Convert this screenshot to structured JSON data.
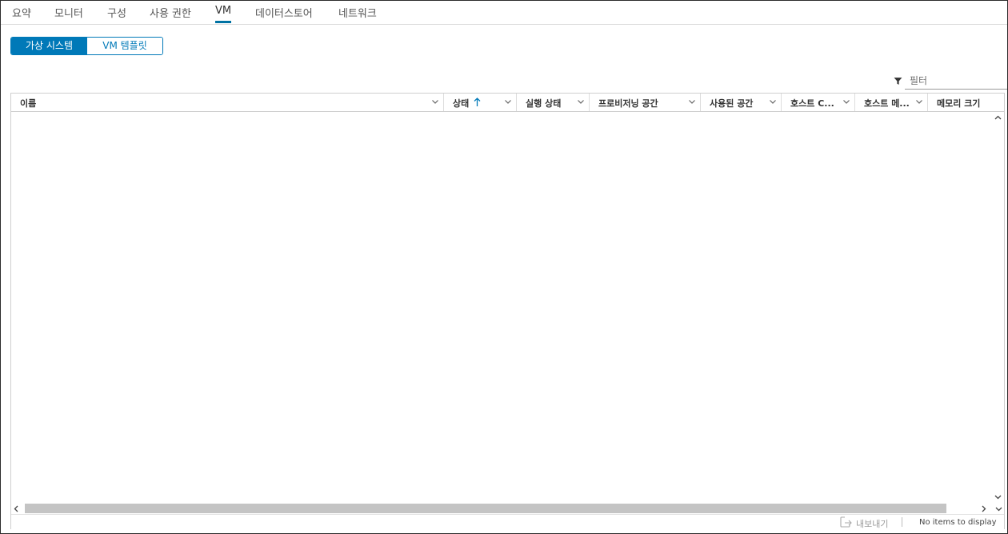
{
  "tabs": [
    {
      "label": "요약"
    },
    {
      "label": "모니터"
    },
    {
      "label": "구성"
    },
    {
      "label": "사용 권한"
    },
    {
      "label": "VM",
      "active": true
    },
    {
      "label": "데이터스토어"
    },
    {
      "label": "네트워크"
    }
  ],
  "toggle": {
    "vms_label": "가상 시스템",
    "templates_label": "VM 템플릿",
    "selected": "가상 시스템"
  },
  "filter": {
    "placeholder": "필터",
    "value": ""
  },
  "grid": {
    "columns": [
      {
        "label": "이름"
      },
      {
        "label": "상태",
        "sorted": "ascending"
      },
      {
        "label": "실행 상태"
      },
      {
        "label": "프로비저닝 공간"
      },
      {
        "label": "사용된 공간"
      },
      {
        "label": "호스트 C..."
      },
      {
        "label": "호스트 메..."
      },
      {
        "label": "메모리 크기"
      }
    ],
    "rows": []
  },
  "footer": {
    "export_label": "내보내기",
    "status": "No items to display"
  },
  "colors": {
    "accent": "#0079b8",
    "tab_underline": "#0072a3",
    "border": "#cfcfcf",
    "scroll_thumb": "#c4c4c4"
  }
}
